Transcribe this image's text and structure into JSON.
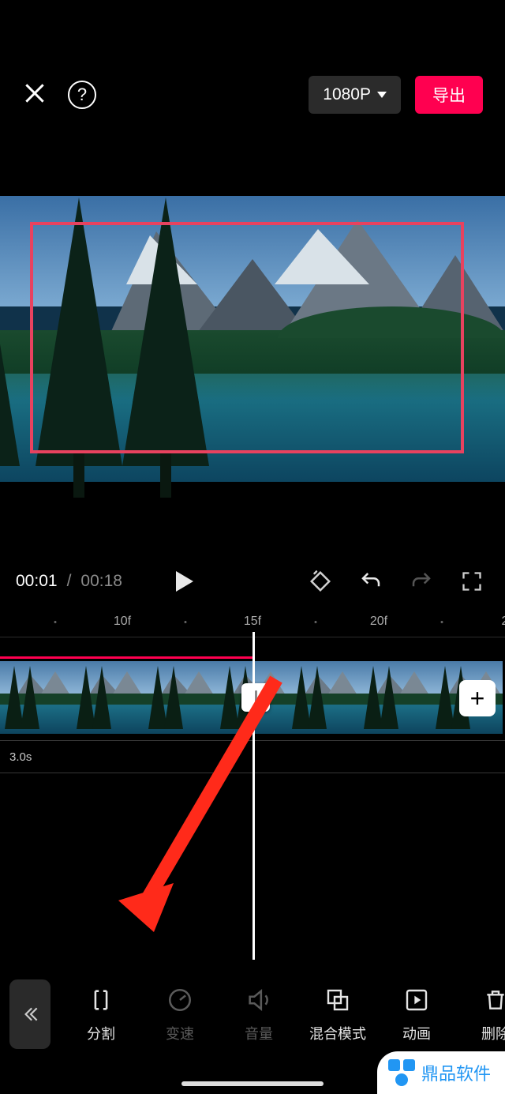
{
  "header": {
    "resolution_label": "1080P",
    "export_label": "导出"
  },
  "playback": {
    "current_time": "00:01",
    "separator": "/",
    "duration": "00:18"
  },
  "ruler": {
    "marks": [
      "10f",
      "15f",
      "20f"
    ]
  },
  "timeline": {
    "clip_duration_label": "3.0s",
    "add_label": "+"
  },
  "toolbar": {
    "items": [
      {
        "id": "split",
        "label": "分割",
        "dim": false
      },
      {
        "id": "speed",
        "label": "变速",
        "dim": true
      },
      {
        "id": "volume",
        "label": "音量",
        "dim": true
      },
      {
        "id": "blend",
        "label": "混合模式",
        "dim": false
      },
      {
        "id": "anim",
        "label": "动画",
        "dim": false
      },
      {
        "id": "delete",
        "label": "删除",
        "dim": false
      }
    ]
  },
  "watermark": {
    "text": "鼎品软件"
  }
}
